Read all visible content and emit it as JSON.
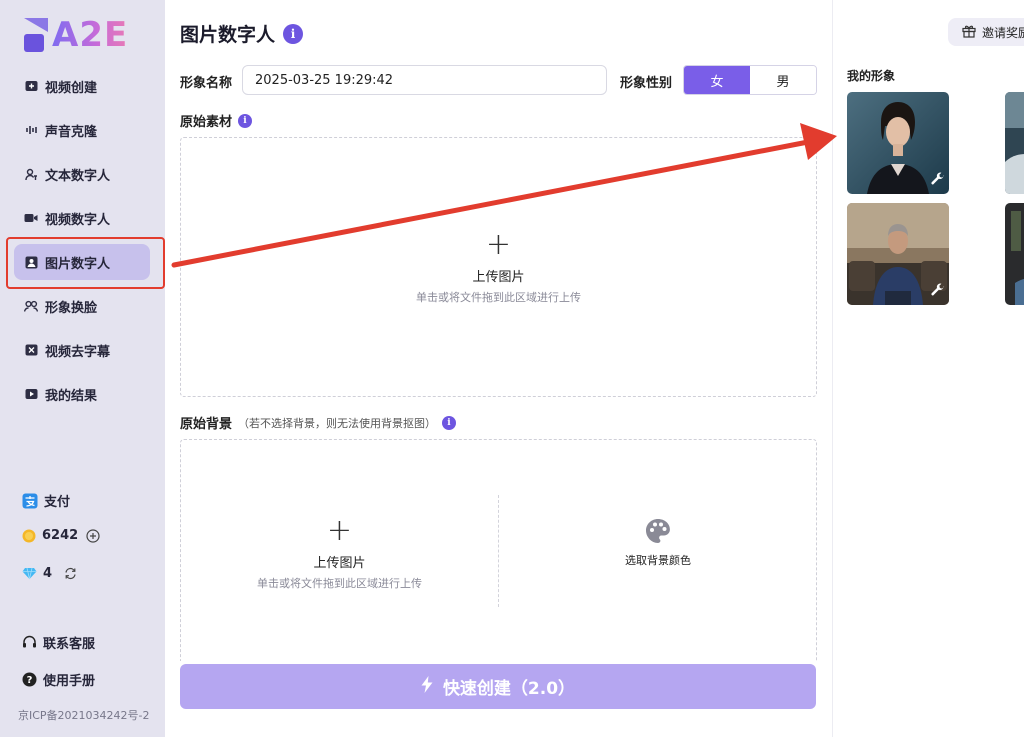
{
  "app": {
    "logo_text": "A2E"
  },
  "sidebar": {
    "items": [
      {
        "label": "视频创建",
        "icon": "video-create-icon"
      },
      {
        "label": "声音克隆",
        "icon": "sound-wave-icon"
      },
      {
        "label": "文本数字人",
        "icon": "text-avatar-icon"
      },
      {
        "label": "视频数字人",
        "icon": "video-avatar-icon"
      },
      {
        "label": "图片数字人",
        "icon": "image-avatar-icon",
        "active": true
      },
      {
        "label": "形象换脸",
        "icon": "face-swap-icon"
      },
      {
        "label": "视频去字幕",
        "icon": "remove-subtitle-icon"
      },
      {
        "label": "我的结果",
        "icon": "results-icon"
      }
    ],
    "pay_label": "支付",
    "coins": "6242",
    "diamonds": "4",
    "support_label": "联系客服",
    "manual_label": "使用手册",
    "icp": "京ICP备2021034242号-2"
  },
  "main": {
    "title": "图片数字人",
    "info_mark": "i",
    "name_label": "形象名称",
    "name_value": "2025-03-25 19:29:42",
    "gender_label": "形象性别",
    "gender_options": [
      "女",
      "男"
    ],
    "source_label": "原始素材",
    "upload_title": "上传图片",
    "upload_hint": "单击或将文件拖到此区域进行上传",
    "background_label": "原始背景",
    "background_note": "（若不选择背景，则无法使用背景抠图）",
    "pick_color_label": "选取背景颜色",
    "create_button": "快速创建（2.0）"
  },
  "right": {
    "invite_label": "邀请奖励",
    "my_avatars_title": "我的形象"
  },
  "colors": {
    "accent": "#7a5ee8",
    "sidebar_bg": "#e4e3ef",
    "annotation_red": "#e23c2e",
    "button_disabled": "#b5a6f1"
  }
}
